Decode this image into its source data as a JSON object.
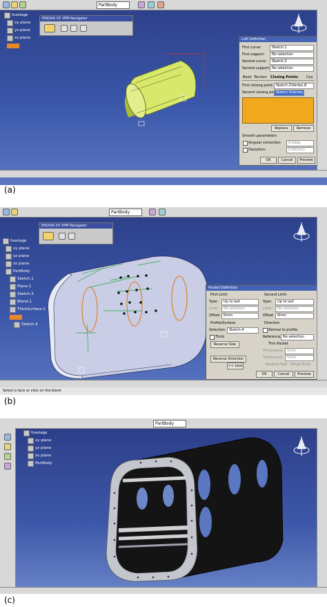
{
  "captions": {
    "a": "(a)",
    "b": "(b)",
    "c": "(c)"
  },
  "part_a": {
    "tree": [
      "fuselage",
      "xy plane",
      "yz plane",
      "zx plane"
    ],
    "nav_title": "ENOVIA V5 VPM Navigator",
    "combo": "PartBody",
    "dialog": {
      "title": "Loft Definition",
      "rows": [
        {
          "label": "First curve:",
          "value": "Sketch.1"
        },
        {
          "label": "First support:",
          "value": "No selection"
        },
        {
          "label": "Second curve:",
          "value": "Sketch.3"
        },
        {
          "label": "Second support:",
          "value": "No selection"
        }
      ],
      "tabs": [
        "Basic",
        "Tension",
        "Closing Points",
        "Cou"
      ],
      "closing": [
        {
          "label": "First closing point:",
          "value": "Sketch.2\\Vertex.8"
        },
        {
          "label": "Second closing point:",
          "value": "Sketch.3\\Vertex"
        }
      ],
      "replace": "Replace",
      "remove": "Remove",
      "smooth": "Smooth parameters",
      "angular": "Angular correction:",
      "angular_val": "0.5deg",
      "deviation": "Deviation:",
      "deviation_val": "0.001mm",
      "ok": "OK",
      "cancel": "Cancel",
      "preview": "Preview"
    }
  },
  "part_b": {
    "tree": [
      "fuselage",
      "xy plane",
      "yz plane",
      "zx plane",
      "PartBody",
      "Sketch.1",
      "Plane.1",
      "Sketch.3",
      "Blend.1",
      "ThickSurface.1",
      "Sketch.4"
    ],
    "nav_title": "ENOVIA V5 VPM Navigator",
    "combo": "PartBody",
    "dialog": {
      "title": "Pocket Definition",
      "first_limit": "First Limit",
      "second_limit": "Second Limit",
      "type_label": "Type:",
      "type_val": "Up to last",
      "limit_label": "Limit:",
      "limit_val": "No selection",
      "offset_label": "Offset:",
      "offset_val": "0mm",
      "profile": "Profile/Surface",
      "selection_label": "Selection:",
      "selection_val": "Sketch.4",
      "thick": "Thick",
      "reverse_side": "Reverse Side",
      "reverse_dir": "Reverse Direction",
      "direction": "Direction",
      "normal": "Normal to profile",
      "reference_label": "Reference:",
      "reference_val": "No selection",
      "thin_pocket": "Thin Pocket",
      "thickness1": "Thickness1:",
      "thickness2": "Thickness2:",
      "thick_val": "1mm",
      "neutral": "Neutral Fiber",
      "merge": "Merge Ends",
      "less": "<< Less",
      "ok": "OK",
      "cancel": "Cancel",
      "preview": "Preview"
    },
    "status": "Select a face or click on the blank"
  },
  "part_c": {
    "tree": [
      "fuselage",
      "xy plane",
      "yz plane",
      "zx plane",
      "PartBody"
    ],
    "combo": "PartBody"
  },
  "colors": {
    "background_top": "#2c3f88",
    "background_bottom": "#5b77c2",
    "surface_a": "#d7e86a",
    "surface_b": "#c9cde6",
    "sketch": "#e07a1a",
    "dimension": "#1fa83a",
    "shell_c": "#141414"
  }
}
